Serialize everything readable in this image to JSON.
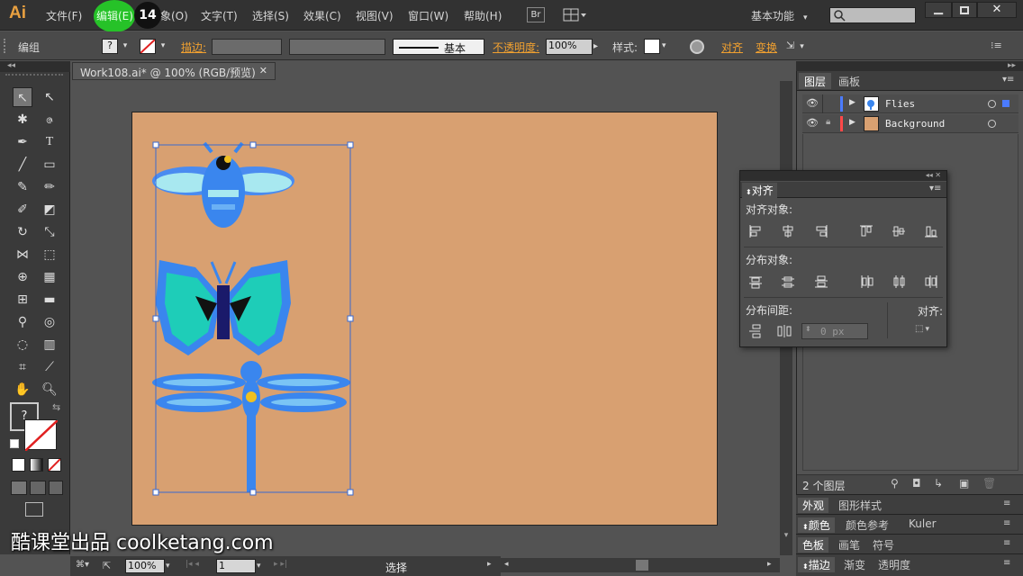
{
  "app": {
    "logo": "Ai"
  },
  "menu": {
    "file": "文件(F)",
    "edit": "编辑(E)",
    "object_tail": "象(O)",
    "text": "文字(T)",
    "select": "选择(S)",
    "effect": "效果(C)",
    "view": "视图(V)",
    "window": "窗口(W)",
    "help": "帮助(H)",
    "bridge": "Br",
    "workspace": "基本功能",
    "step_badge": "14"
  },
  "control": {
    "selection_label": "编组",
    "fill_value": "?",
    "stroke_label": "描边:",
    "stroke_style": "基本",
    "opacity_label": "不透明度:",
    "opacity_value": "100%",
    "style_label": "样式:",
    "align_label": "对齐",
    "transform_label": "变换"
  },
  "document": {
    "tab_title": "Work108.ai* @ 100% (RGB/预览)"
  },
  "tools": {
    "fill_placeholder": "?"
  },
  "status": {
    "zoom": "100%",
    "artboard_num": "1",
    "tool_name": "选择"
  },
  "layers_panel": {
    "tabs": [
      "图层",
      "画板"
    ],
    "layers": [
      {
        "name": "Flies",
        "color": "#4b7bff"
      },
      {
        "name": "Background",
        "color": "#ff4848"
      }
    ],
    "count_label": "2 个图层"
  },
  "align_panel": {
    "title": "对齐",
    "align_objects": "对齐对象:",
    "distribute_objects": "分布对象:",
    "distribute_spacing": "分布间距:",
    "align_to": "对齐:",
    "spacing_value": "0 px"
  },
  "collapsed_panels": [
    {
      "tabs": [
        "外观",
        "图形样式"
      ]
    },
    {
      "tabs": [
        "颜色",
        "颜色参考",
        "Kuler"
      ]
    },
    {
      "tabs": [
        "色板",
        "画笔",
        "符号"
      ]
    },
    {
      "tabs": [
        "描边",
        "渐变",
        "透明度"
      ]
    }
  ],
  "watermark": "酷课堂出品 coolketang.com"
}
